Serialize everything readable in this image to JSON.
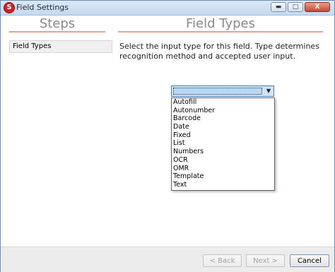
{
  "window": {
    "title": "Field Settings",
    "app_icon_letter": "S",
    "controls": {
      "minimize": "▬",
      "maximize": "□",
      "close": "X"
    }
  },
  "steps": {
    "header": "Steps",
    "items": [
      {
        "label": "Field Types"
      }
    ]
  },
  "main": {
    "header": "Field Types",
    "instruction": "Select the input type for this field. Type determines recognition method and accepted user input.",
    "combo": {
      "value": "",
      "arrow": "▼"
    },
    "options": [
      "Autofill",
      "Autonumber",
      "Barcode",
      "Date",
      "Fixed",
      "List",
      "Numbers",
      "OCR",
      "OMR",
      "Template",
      "Text"
    ]
  },
  "footer": {
    "back_label": "< Back",
    "next_label": "Next >",
    "cancel_label": "Cancel"
  },
  "colors": {
    "header_underline": "#e4a58a",
    "combo_selection": "#cfe4f8"
  }
}
